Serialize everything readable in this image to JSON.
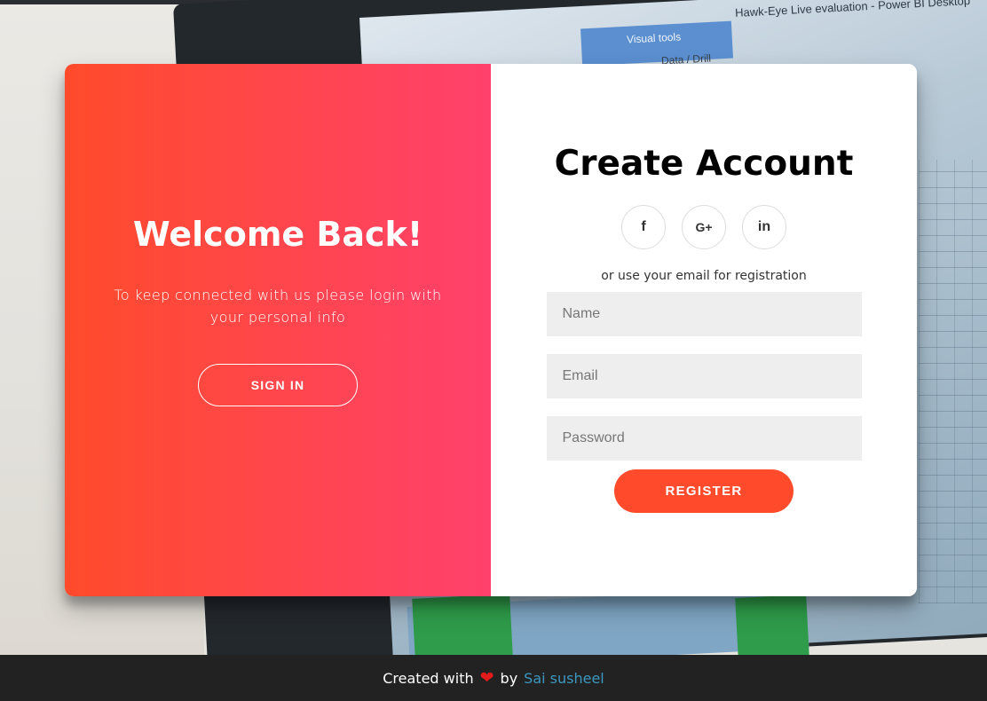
{
  "background": {
    "window_title": "Hawk-Eye Live evaluation - Power BI Desktop",
    "ribbon_tab": "Visual tools",
    "ribbon_sub": "Data / Drill"
  },
  "overlay": {
    "title": "Welcome Back!",
    "message": "To keep connected with us please login with your personal info",
    "signin_label": "SIGN IN"
  },
  "form": {
    "title": "Create Account",
    "social": [
      {
        "icon": "facebook-icon",
        "glyph": "f"
      },
      {
        "icon": "google-plus-icon",
        "glyph": "G+"
      },
      {
        "icon": "linkedin-icon",
        "glyph": "in"
      }
    ],
    "hint": "or use your email for registration",
    "name_placeholder": "Name",
    "email_placeholder": "Email",
    "password_placeholder": "Password",
    "register_label": "REGISTER"
  },
  "footer": {
    "prefix": "Created with",
    "heart": "❤",
    "by": "by",
    "author": "Sai susheel"
  },
  "colors": {
    "gradient_start": "#ff4b2b",
    "gradient_end": "#ff416c",
    "primary": "#ff4b2b",
    "footer_bg": "#222222",
    "author_link": "#3c97bf"
  }
}
